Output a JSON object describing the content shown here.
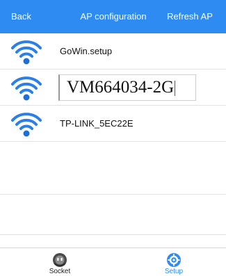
{
  "header": {
    "back_label": "Back",
    "title": "AP configuration",
    "refresh_label": "Refresh AP",
    "background": "#2d8bf2"
  },
  "networks": [
    {
      "ssid": "GoWin.setup",
      "icon": "wifi-icon"
    },
    {
      "ssid": "VM664034-2G",
      "icon": "wifi-icon",
      "editing": true
    },
    {
      "ssid": "TP-LINK_5EC22E",
      "icon": "wifi-icon"
    }
  ],
  "tabs": [
    {
      "label": "Socket",
      "icon": "socket-icon",
      "selected": false
    },
    {
      "label": "Setup",
      "icon": "setup-icon",
      "selected": true
    }
  ],
  "colors": {
    "accent": "#2d8bf2",
    "wifi_icon": "#2b7fe6",
    "inactive_tab": "#555555"
  }
}
